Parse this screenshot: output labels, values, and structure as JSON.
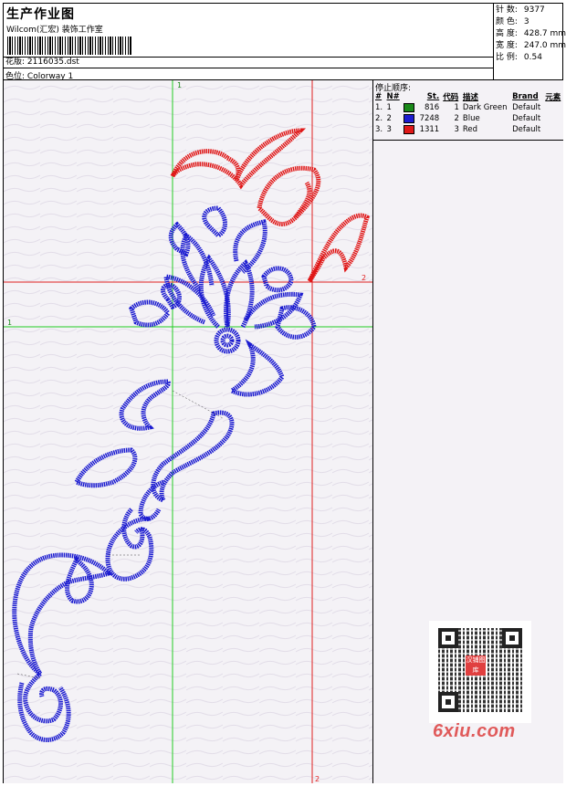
{
  "header": {
    "title": "生产作业图",
    "studio": "Wilcom(汇宏) 装饰工作室",
    "design_label": "花版:",
    "design_value": "2116035.dst",
    "colorway_label": "色位:",
    "colorway_value": "Colorway 1"
  },
  "specs": [
    {
      "label": "针 数:",
      "value": "9377"
    },
    {
      "label": "颜 色:",
      "value": "3"
    },
    {
      "label": "高 度:",
      "value": "428.7 mm"
    },
    {
      "label": "宽 度:",
      "value": "247.0 mm"
    },
    {
      "label": "比 例:",
      "value": "0.54"
    }
  ],
  "stop_sequence": {
    "heading": "停止顺序:",
    "columns": [
      "#",
      "N#",
      "St.",
      "代码",
      "描述",
      "Brand",
      "元素"
    ],
    "rows": [
      {
        "num": "1.",
        "n": "1",
        "color": "#1a8a1a",
        "st": "816",
        "code": "1",
        "desc": "Dark Green",
        "brand": "Default"
      },
      {
        "num": "2.",
        "n": "2",
        "color": "#1c1cd0",
        "st": "7248",
        "code": "2",
        "desc": "Blue",
        "brand": "Default"
      },
      {
        "num": "3.",
        "n": "3",
        "color": "#e01818",
        "st": "1311",
        "code": "3",
        "desc": "Red",
        "brand": "Default"
      }
    ]
  },
  "guides": {
    "green_label": "1",
    "red_label": "2"
  },
  "watermark": {
    "text": "6xiu.com",
    "seal": "汉铺图库"
  },
  "colors": {
    "green_guide": "#22cc22",
    "red_guide": "#e02020",
    "blue_thread": "#1c1cd0",
    "red_thread": "#e01818"
  }
}
